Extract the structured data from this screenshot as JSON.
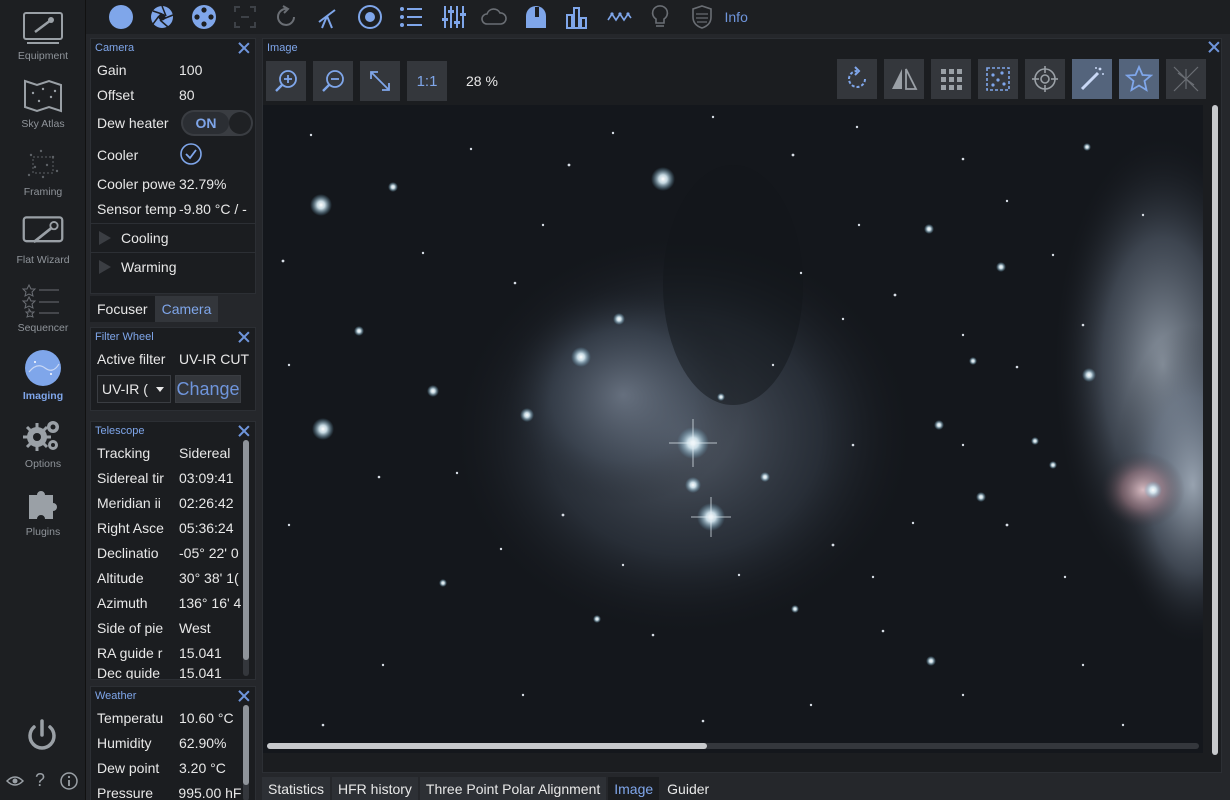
{
  "sidebar": {
    "items": [
      {
        "label": "Equipment",
        "icon": "equipment-icon"
      },
      {
        "label": "Sky Atlas",
        "icon": "sky-atlas-icon"
      },
      {
        "label": "Framing",
        "icon": "framing-icon"
      },
      {
        "label": "Flat Wizard",
        "icon": "flat-wizard-icon"
      },
      {
        "label": "Sequencer",
        "icon": "sequencer-icon"
      },
      {
        "label": "Imaging",
        "icon": "imaging-icon",
        "active": true
      },
      {
        "label": "Options",
        "icon": "options-icon"
      },
      {
        "label": "Plugins",
        "icon": "plugins-icon"
      }
    ]
  },
  "topbar": {
    "info_label": "Info"
  },
  "camera": {
    "title": "Camera",
    "rows": [
      {
        "k": "Gain",
        "v": "100"
      },
      {
        "k": "Offset",
        "v": "80"
      }
    ],
    "dew_heater_label": "Dew heater",
    "dew_heater_state": "ON",
    "cooler_label": "Cooler",
    "cooler_power_label": "Cooler powe",
    "cooler_power_value": "32.79%",
    "sensor_temp_label": "Sensor temp",
    "sensor_temp_value": "-9.80 °C / -",
    "cooling_label": "Cooling",
    "warming_label": "Warming"
  },
  "tabs_focuser_camera": {
    "focuser": "Focuser",
    "camera": "Camera"
  },
  "filter_wheel": {
    "title": "Filter Wheel",
    "active_filter_label": "Active filter",
    "active_filter_value": "UV-IR CUT",
    "select_value": "UV-IR (",
    "change_label": "Change"
  },
  "telescope": {
    "title": "Telescope",
    "rows": [
      {
        "k": "Tracking",
        "v": "Sidereal"
      },
      {
        "k": "Sidereal tir",
        "v": "03:09:41"
      },
      {
        "k": "Meridian ii",
        "v": "02:26:42"
      },
      {
        "k": "Right Asce",
        "v": "05:36:24"
      },
      {
        "k": "Declinatio",
        "v": "-05° 22' 0"
      },
      {
        "k": "Altitude",
        "v": "30° 38' 1("
      },
      {
        "k": "Azimuth",
        "v": "136° 16' 4"
      },
      {
        "k": "Side of pie",
        "v": "West"
      },
      {
        "k": "RA guide r",
        "v": "15.041"
      },
      {
        "k": "Dec guide",
        "v": "15.041"
      }
    ]
  },
  "weather": {
    "title": "Weather",
    "rows": [
      {
        "k": "Temperatu",
        "v": "10.60 °C"
      },
      {
        "k": "Humidity",
        "v": "62.90%"
      },
      {
        "k": "Dew point",
        "v": "3.20 °C"
      },
      {
        "k": "Pressure",
        "v": "995.00 hF"
      }
    ]
  },
  "image_panel": {
    "title": "Image",
    "one_to_one": "1:1",
    "zoom": "28 %"
  },
  "bottom_tabs": [
    {
      "label": "Statistics"
    },
    {
      "label": "HFR history"
    },
    {
      "label": "Three Point Polar Alignment"
    },
    {
      "label": "Image",
      "selected": true
    },
    {
      "label": "Guider"
    }
  ],
  "colors": {
    "accent": "#6f95dc",
    "panel": "#1b1d20",
    "background": "#25272b"
  }
}
